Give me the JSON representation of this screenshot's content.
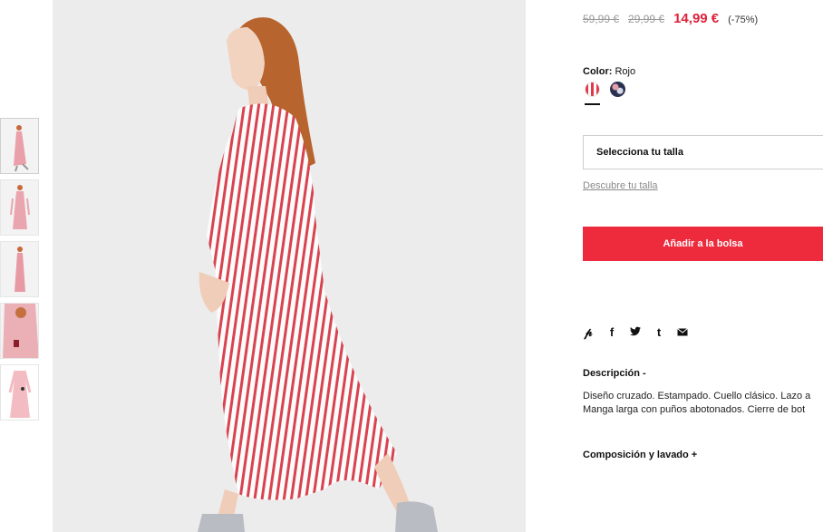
{
  "product": {
    "prices": {
      "original": "59,99 €",
      "previous": "29,99 €",
      "current": "14,99 €",
      "discount": "(-75%)"
    },
    "color": {
      "label": "Color:",
      "value": "Rojo",
      "swatches": [
        "red-striped-swatch",
        "navy-floral-swatch"
      ]
    },
    "size": {
      "select_label": "Selecciona tu talla",
      "guide_link": "Descubre tu talla"
    },
    "add_to_bag": "Añadir a la bolsa",
    "share_icons": [
      "pinterest-icon",
      "facebook-icon",
      "twitter-icon",
      "tumblr-icon",
      "email-icon"
    ],
    "description": {
      "title": "Descripción -",
      "line1": "Diseño cruzado. Estampado. Cuello clásico. Lazo a",
      "line2": "Manga larga con puños abotonados. Cierre de bot"
    },
    "composition_title": "Composición y lavado +"
  },
  "gallery": {
    "thumbnail_count": 5,
    "active_thumbnail": 1
  },
  "colors": {
    "accent": "#ee2b3d",
    "sale_price": "#e0203a"
  }
}
